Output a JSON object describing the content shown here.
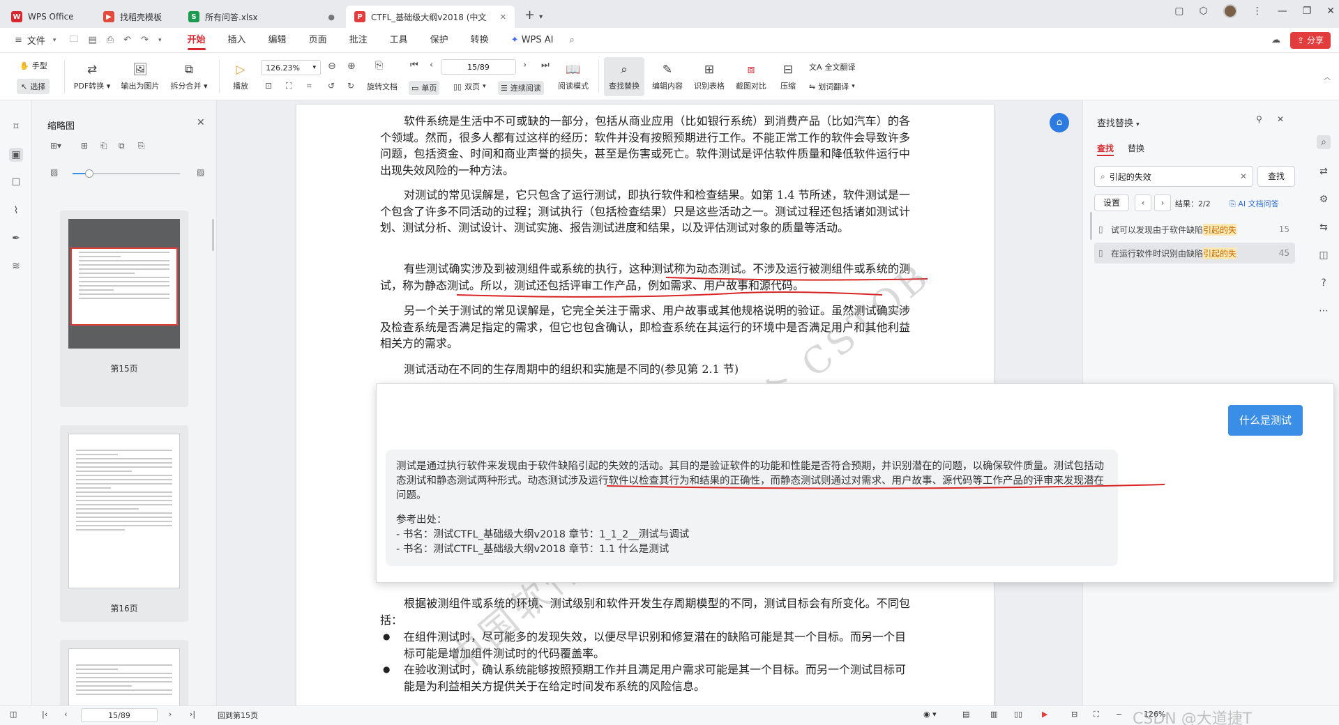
{
  "tabs": [
    {
      "icon": "W",
      "color": "#d6282e",
      "label": "WPS Office"
    },
    {
      "icon": "▶",
      "color": "#e24a3b",
      "label": "找稻壳模板"
    },
    {
      "icon": "S",
      "color": "#1c9a4f",
      "label": "所有问答.xlsx"
    },
    {
      "icon": "P",
      "color": "#e23c3c",
      "label": "CTFL_基础级大纲v2018 (中文"
    }
  ],
  "menu": {
    "file": "文件",
    "items": [
      "开始",
      "插入",
      "编辑",
      "页面",
      "批注",
      "工具",
      "保护",
      "转换"
    ],
    "active": "开始",
    "wps_ai": "WPS AI",
    "share": "分享"
  },
  "toolbar": {
    "hand": "手型",
    "select": "选择",
    "pdf_convert": "PDF转换",
    "export_image": "输出为图片",
    "split_merge": "拆分合并",
    "play": "播放",
    "zoom": "126.23%",
    "page": "15/89",
    "rotate": "旋转文档",
    "single": "单页",
    "double": "双页",
    "continuous": "连续阅读",
    "read_mode": "阅读模式",
    "find_replace": "查找替换",
    "edit_content": "编辑内容",
    "recognize_table": "识别表格",
    "screenshot_compare": "截图对比",
    "compress": "压缩",
    "translate_all": "全文翻译",
    "translate_word": "划词翻译"
  },
  "thumbnails": {
    "title": "缩略图",
    "pages": [
      "第15页",
      "第16页"
    ]
  },
  "document": {
    "paragraphs": [
      "软件系统是生活中不可或缺的一部分，包括从商业应用（比如银行系统）到消费产品（比如汽车）的各个领域。然而，很多人都有过这样的经历：软件并没有按照预期进行工作。不能正常工作的软件会导致许多问题，包括资金、时间和商业声誉的损失，甚至是伤害或死亡。软件测试是评估软件质量和降低软件运行中出现失效风险的一种方法。",
      "对测试的常见误解是，它只包含了运行测试，即执行软件和检查结果。如第 1.4 节所述，软件测试是一个包含了许多不同活动的过程；测试执行（包括检查结果）只是这些活动之一。测试过程还包括诸如测试计划、测试分析、测试设计、测试实施、报告测试进度和结果，以及评估测试对象的质量等活动。",
      "有些测试确实涉及到被测组件或系统的执行，这种测试称为动态测试。不涉及运行被测组件或系统的测试，称为静态测试。所以，测试还包括评审工作产品，例如需求、用户故事和源代码。",
      "另一个关于测试的常见误解是，它完全关注于需求、用户故事或其他规格说明的验证。虽然测试确实涉及检查系统是否满足指定的需求，但它也包含确认，即检查系统在其运行的环境中是否满足用户和其他利益相关方的需求。",
      "测试活动在不同的生存周期中的组织和实施是不同的(参见第 2.1 节)",
      "根据被测组件或系统的环境、测试级别和软件开发生存周期模型的不同，测试目标会有所变化。不同包括："
    ],
    "bullets": [
      "在组件测试时，尽可能多的发现失效，以便尽早识别和修复潜在的缺陷可能是其一个目标。而另一个目标可能是增加组件测试时的代码覆盖率。",
      "在验收测试时，确认系统能够按照预期工作并且满足用户需求可能是其一个目标。而另一个测试目标可能是为利益相关方提供关于在给定时间发布系统的风险信息。"
    ],
    "watermark": "中国软件测试认证委员会 CSTQB"
  },
  "ai": {
    "question": "什么是测试",
    "answer": "测试是通过执行软件来发现由于软件缺陷引起的失效的活动。其目的是验证软件的功能和性能是否符合预期，并识别潜在的问题，以确保软件质量。测试包括动态测试和静态测试两种形式。动态测试涉及运行软件以检查其行为和结果的正确性，而静态测试则通过对需求、用户故事、源代码等工作产品的评审来发现潜在问题。",
    "ref_title": "参考出处：",
    "refs": [
      "- 书名：测试CTFL_基础级大纲v2018 章节：1_1_2__测试与调试",
      "- 书名：测试CTFL_基础级大纲v2018 章节：1.1 什么是测试"
    ]
  },
  "find": {
    "title": "查找替换",
    "tab_find": "查找",
    "tab_replace": "替换",
    "query": "引起的失效",
    "search_btn": "查找",
    "settings": "设置",
    "result_count": "结果：2/2",
    "ai_qa": "AI 文档问答",
    "results": [
      {
        "prefix": "试可以发现由于软件缺陷",
        "match": "引起的失",
        "page": "15"
      },
      {
        "prefix": "在运行软件时识别由缺陷",
        "match": "引起的失",
        "page": "45"
      }
    ]
  },
  "status": {
    "page": "15/89",
    "goto": "回到第15页",
    "zoom": "126%",
    "brand": "CSDN @大道捷T"
  }
}
